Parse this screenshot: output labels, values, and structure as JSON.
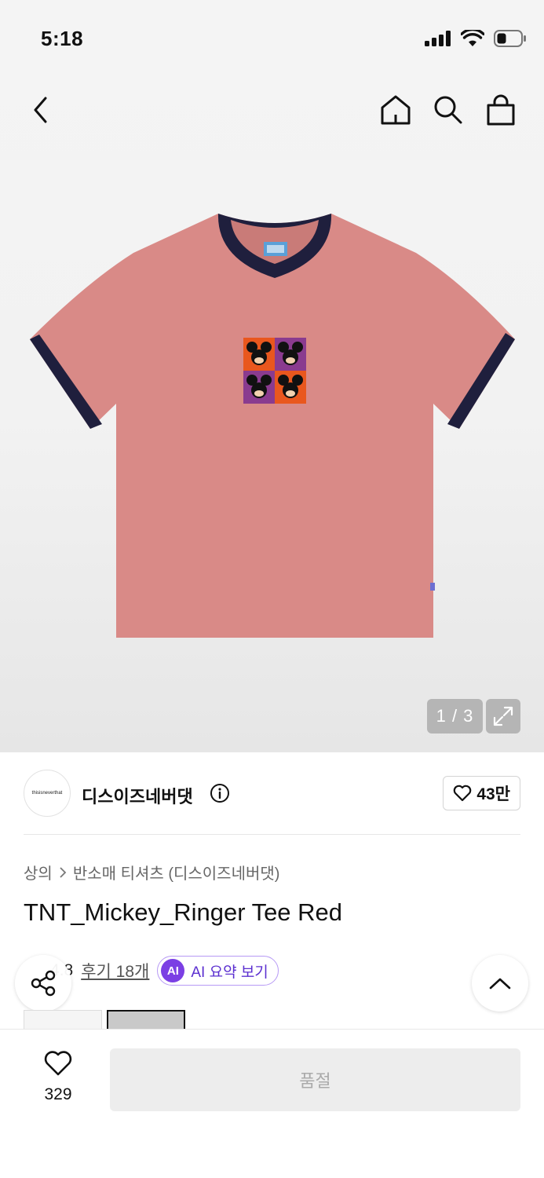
{
  "status": {
    "time": "5:18"
  },
  "gallery": {
    "counter": "1 / 3"
  },
  "brand": {
    "name": "디스이즈네버댓",
    "logo_text": "thisisneverthat",
    "likes": "43만"
  },
  "breadcrumb": {
    "category": "상의",
    "sub": "반소매 티셔츠 (디스이즈네버댓)"
  },
  "product": {
    "title": "TNT_Mickey_Ringer Tee Red"
  },
  "rating": {
    "value": "4.8",
    "reviews": "후기 18개",
    "ai_label": "AI",
    "ai_summary": "AI 요약 보기"
  },
  "bottom": {
    "wish_count": "329",
    "buy_label": "품절"
  },
  "colors": {
    "shirt": "#d98a87",
    "trim": "#1f1f3d",
    "accent": "#7b3fe4"
  }
}
